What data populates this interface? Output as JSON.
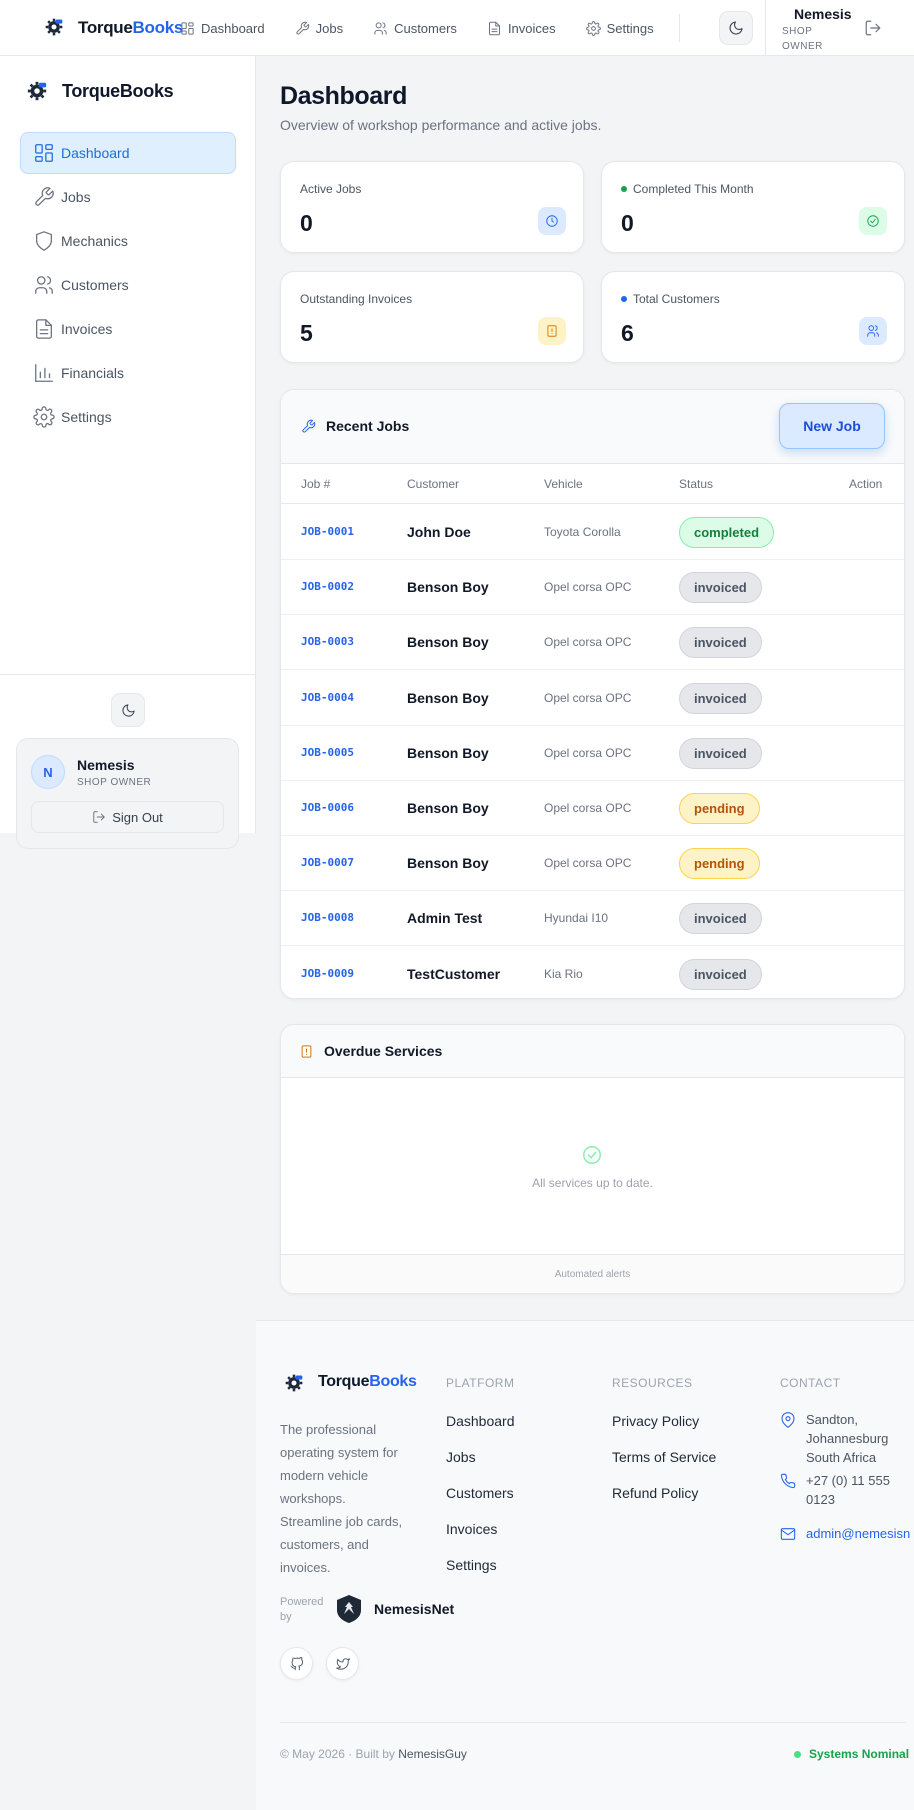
{
  "brand": {
    "part1": "Torque",
    "part2": "Books",
    "full": "TorqueBooks"
  },
  "topnav": [
    {
      "label": "Dashboard",
      "icon": "dashboard-icon"
    },
    {
      "label": "Jobs",
      "icon": "wrench-icon"
    },
    {
      "label": "Customers",
      "icon": "users-icon"
    },
    {
      "label": "Invoices",
      "icon": "file-icon"
    },
    {
      "label": "Settings",
      "icon": "gear-icon"
    }
  ],
  "user": {
    "name": "Nemesis",
    "role_top": "SHOP OWNER",
    "role": "SHOP OWNER",
    "initial": "N"
  },
  "sidebar": {
    "items": [
      {
        "label": "Dashboard",
        "icon": "dashboard-icon",
        "active": true
      },
      {
        "label": "Jobs",
        "icon": "wrench-icon"
      },
      {
        "label": "Mechanics",
        "icon": "shield-icon"
      },
      {
        "label": "Customers",
        "icon": "users-icon"
      },
      {
        "label": "Invoices",
        "icon": "file-icon"
      },
      {
        "label": "Financials",
        "icon": "bar-chart-icon"
      },
      {
        "label": "Settings",
        "icon": "gear-icon"
      }
    ],
    "signout": "Sign Out"
  },
  "page": {
    "title": "Dashboard",
    "subtitle": "Overview of workshop performance and active jobs."
  },
  "stats": [
    {
      "label": "Active Jobs",
      "value": "0",
      "dot": "",
      "icon": "clock-icon",
      "icon_bg": "#dbeafe",
      "icon_color": "#2563eb"
    },
    {
      "label": "Completed This Month",
      "value": "0",
      "dot": "#16a34a",
      "icon": "check-circle-icon",
      "icon_bg": "#dcfce7",
      "icon_color": "#16a34a"
    },
    {
      "label": "Outstanding Invoices",
      "value": "5",
      "dot": "",
      "icon": "alert-file-icon",
      "icon_bg": "#fef3c7",
      "icon_color": "#d97706"
    },
    {
      "label": "Total Customers",
      "value": "6",
      "dot": "#2563eb",
      "icon": "users-icon",
      "icon_bg": "#dbeafe",
      "icon_color": "#2563eb"
    }
  ],
  "recent_jobs": {
    "title": "Recent Jobs",
    "new_job_label": "New Job",
    "columns": [
      "Job #",
      "Customer",
      "Vehicle",
      "Status",
      "Action"
    ],
    "rows": [
      {
        "job": "JOB-0001",
        "customer": "John Doe",
        "vehicle": "Toyota Corolla",
        "status": "completed"
      },
      {
        "job": "JOB-0002",
        "customer": "Benson Boy",
        "vehicle": "Opel corsa OPC",
        "status": "invoiced"
      },
      {
        "job": "JOB-0003",
        "customer": "Benson Boy",
        "vehicle": "Opel corsa OPC",
        "status": "invoiced"
      },
      {
        "job": "JOB-0004",
        "customer": "Benson Boy",
        "vehicle": "Opel corsa OPC",
        "status": "invoiced"
      },
      {
        "job": "JOB-0005",
        "customer": "Benson Boy",
        "vehicle": "Opel corsa OPC",
        "status": "invoiced"
      },
      {
        "job": "JOB-0006",
        "customer": "Benson Boy",
        "vehicle": "Opel corsa OPC",
        "status": "pending"
      },
      {
        "job": "JOB-0007",
        "customer": "Benson Boy",
        "vehicle": "Opel corsa OPC",
        "status": "pending"
      },
      {
        "job": "JOB-0008",
        "customer": "Admin Test",
        "vehicle": "Hyundai I10",
        "status": "invoiced"
      },
      {
        "job": "JOB-0009",
        "customer": "TestCustomer",
        "vehicle": "Kia Rio",
        "status": "invoiced"
      }
    ]
  },
  "overdue": {
    "title": "Overdue Services",
    "empty": "All services up to date.",
    "footer": "Automated alerts"
  },
  "footer": {
    "description": "The professional operating system for modern vehicle workshops. Streamline job cards, customers, and invoices.",
    "powered_by": "Powered by",
    "partner": "NemesisNet",
    "columns": {
      "platform": {
        "heading": "PLATFORM",
        "links": [
          "Dashboard",
          "Jobs",
          "Customers",
          "Invoices",
          "Settings"
        ]
      },
      "resources": {
        "heading": "RESOURCES",
        "links": [
          "Privacy Policy",
          "Terms of Service",
          "Refund Policy"
        ]
      },
      "contact": {
        "heading": "CONTACT",
        "address": "Sandton,\nJohannesburg\nSouth Africa",
        "phone": "+27 (0) 11 555\n0123",
        "email": "admin@nemesisn"
      }
    },
    "copyright": "© May 2026 · Built by",
    "author": "NemesisGuy",
    "status": "Systems Nominal"
  },
  "colors": {
    "accent": "#2563eb",
    "success": "#16a34a",
    "warning": "#d97706"
  }
}
